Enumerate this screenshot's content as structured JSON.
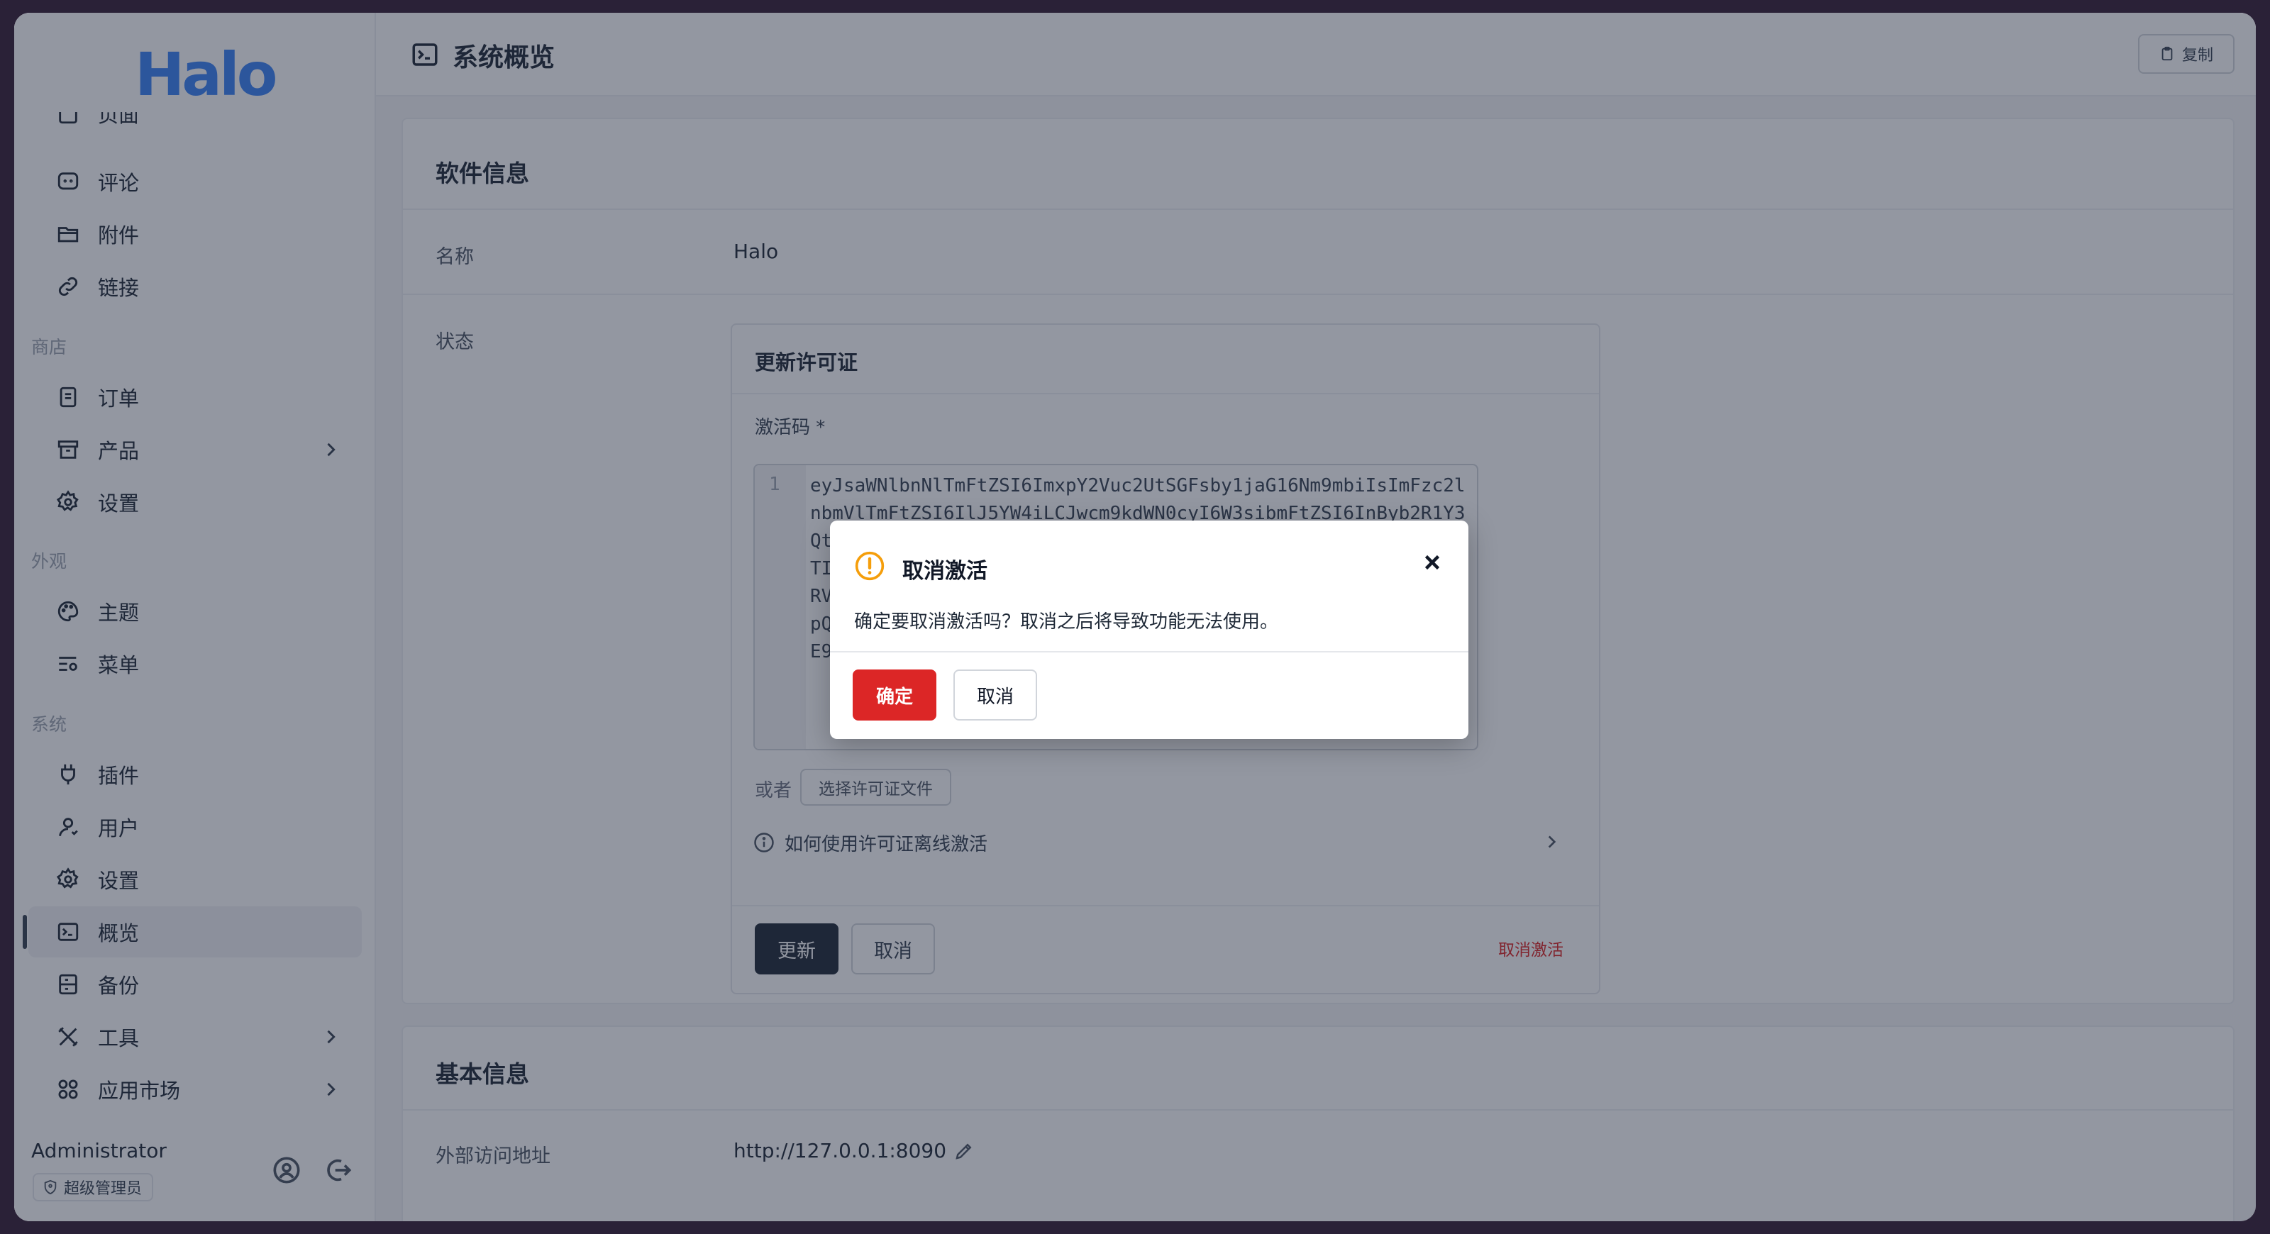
{
  "brand": {
    "logo_text": "Halo",
    "accent": "#3b82f6"
  },
  "sidebar": {
    "partial_top_item": "页面",
    "groups": [
      {
        "label": "商店"
      },
      {
        "label": "外观"
      },
      {
        "label": "系统"
      }
    ],
    "items": [
      {
        "label": "评论",
        "icon": "comment-icon"
      },
      {
        "label": "附件",
        "icon": "folder-icon"
      },
      {
        "label": "链接",
        "icon": "link-icon"
      },
      {
        "label": "订单",
        "icon": "receipt-icon"
      },
      {
        "label": "产品",
        "icon": "archive-icon",
        "has_children": true
      },
      {
        "label": "设置",
        "icon": "gear-icon"
      },
      {
        "label": "主题",
        "icon": "palette-icon"
      },
      {
        "label": "菜单",
        "icon": "menu-settings-icon"
      },
      {
        "label": "插件",
        "icon": "plug-icon"
      },
      {
        "label": "用户",
        "icon": "user-icon"
      },
      {
        "label": "设置",
        "icon": "gear-icon"
      },
      {
        "label": "概览",
        "icon": "terminal-icon",
        "active": true
      },
      {
        "label": "备份",
        "icon": "backup-icon"
      },
      {
        "label": "工具",
        "icon": "tools-icon",
        "has_children": true
      },
      {
        "label": "应用市场",
        "icon": "apps-icon",
        "has_children": true
      }
    ],
    "user": {
      "name": "Administrator",
      "role": "超级管理员"
    }
  },
  "header": {
    "title": "系统概览",
    "copy_label": "复制"
  },
  "software_card": {
    "title": "软件信息",
    "name_label": "名称",
    "name_value": "Halo",
    "status_label": "状态"
  },
  "license_form": {
    "title": "更新许可证",
    "code_label": "激活码 *",
    "line_number": "1",
    "code_text": "eyJsaWNlbnNlTmFtZSI6ImxpY2Vuc2UtSGFsby1jaG16Nm9mbiIsImFzc2lnbmVlTmFtZSI6IlJ5YW4iLCJwcm9kdWN0cyI6W3sibmFtZSI6InByb2R1Y3QtaGFsby1wcm8iLCJ2ZXJzaW9uIjoiMS4wIiwiZXhwaXJlcyI6IjIwMjUtMTItMzEifV0sImlzc3VlZCI6IjIwMjQtMDEtMDEiLCJzaWduYXR1cmUiOiJNRVFDSUZGOGxXeWpRYVdHbjVrZlRnVkRNa3pPamJLdzR6VHZOY3ZjaEtwV0FpQWZ4R3pLaWJ0WnBqV0xtRFZzbE1rT2J4TnVQcVdUb3lFZVpSa2NHYldiZUE9PSJ9fQ",
    "or_label": "或者",
    "choose_file_label": "选择许可证文件",
    "help_text": "如何使用许可证离线激活",
    "update_label": "更新",
    "cancel_label": "取消",
    "deactivate_label": "取消激活"
  },
  "basic_card": {
    "title": "基本信息",
    "url_label": "外部访问地址",
    "url_value": "http://127.0.0.1:8090"
  },
  "dialog": {
    "title": "取消激活",
    "message": "确定要取消激活吗？取消之后将导致功能无法使用。",
    "confirm_label": "确定",
    "cancel_label": "取消",
    "warning_color": "#f59e0b",
    "danger_color": "#dc2626"
  }
}
